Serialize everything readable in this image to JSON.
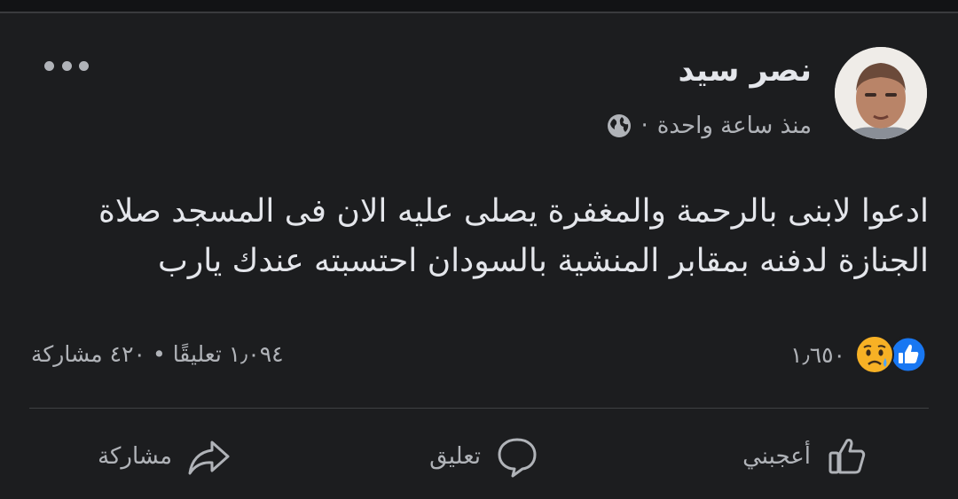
{
  "post": {
    "author": "نصر سيد",
    "time": "منذ ساعة واحدة",
    "separator": "·",
    "privacy_icon": "globe-icon",
    "body_line_1": "ادعوا لابنى بالرحمة والمغفرة يصلى عليه الان فى المسجد صلاة",
    "body_line_2": "الجنازة لدفنه بمقابر المنشية بالسودان  احتسبته عندك يارب"
  },
  "stats": {
    "reaction_icons": [
      "sad-emoji",
      "like"
    ],
    "reaction_count": "١٫٦٥٠",
    "comments": "١٫٠٩٤ تعليقًا",
    "dot": "•",
    "shares": "٤٢٠ مشاركة"
  },
  "actions": {
    "like_label": "أعجبني",
    "comment_label": "تعليق",
    "share_label": "مشاركة"
  },
  "colors": {
    "background": "#1c1d1f",
    "text": "#e4e6eb",
    "secondary_text": "#b0b3b8",
    "like_blue": "#1877f2",
    "sad_yellow": "#f7b125"
  }
}
